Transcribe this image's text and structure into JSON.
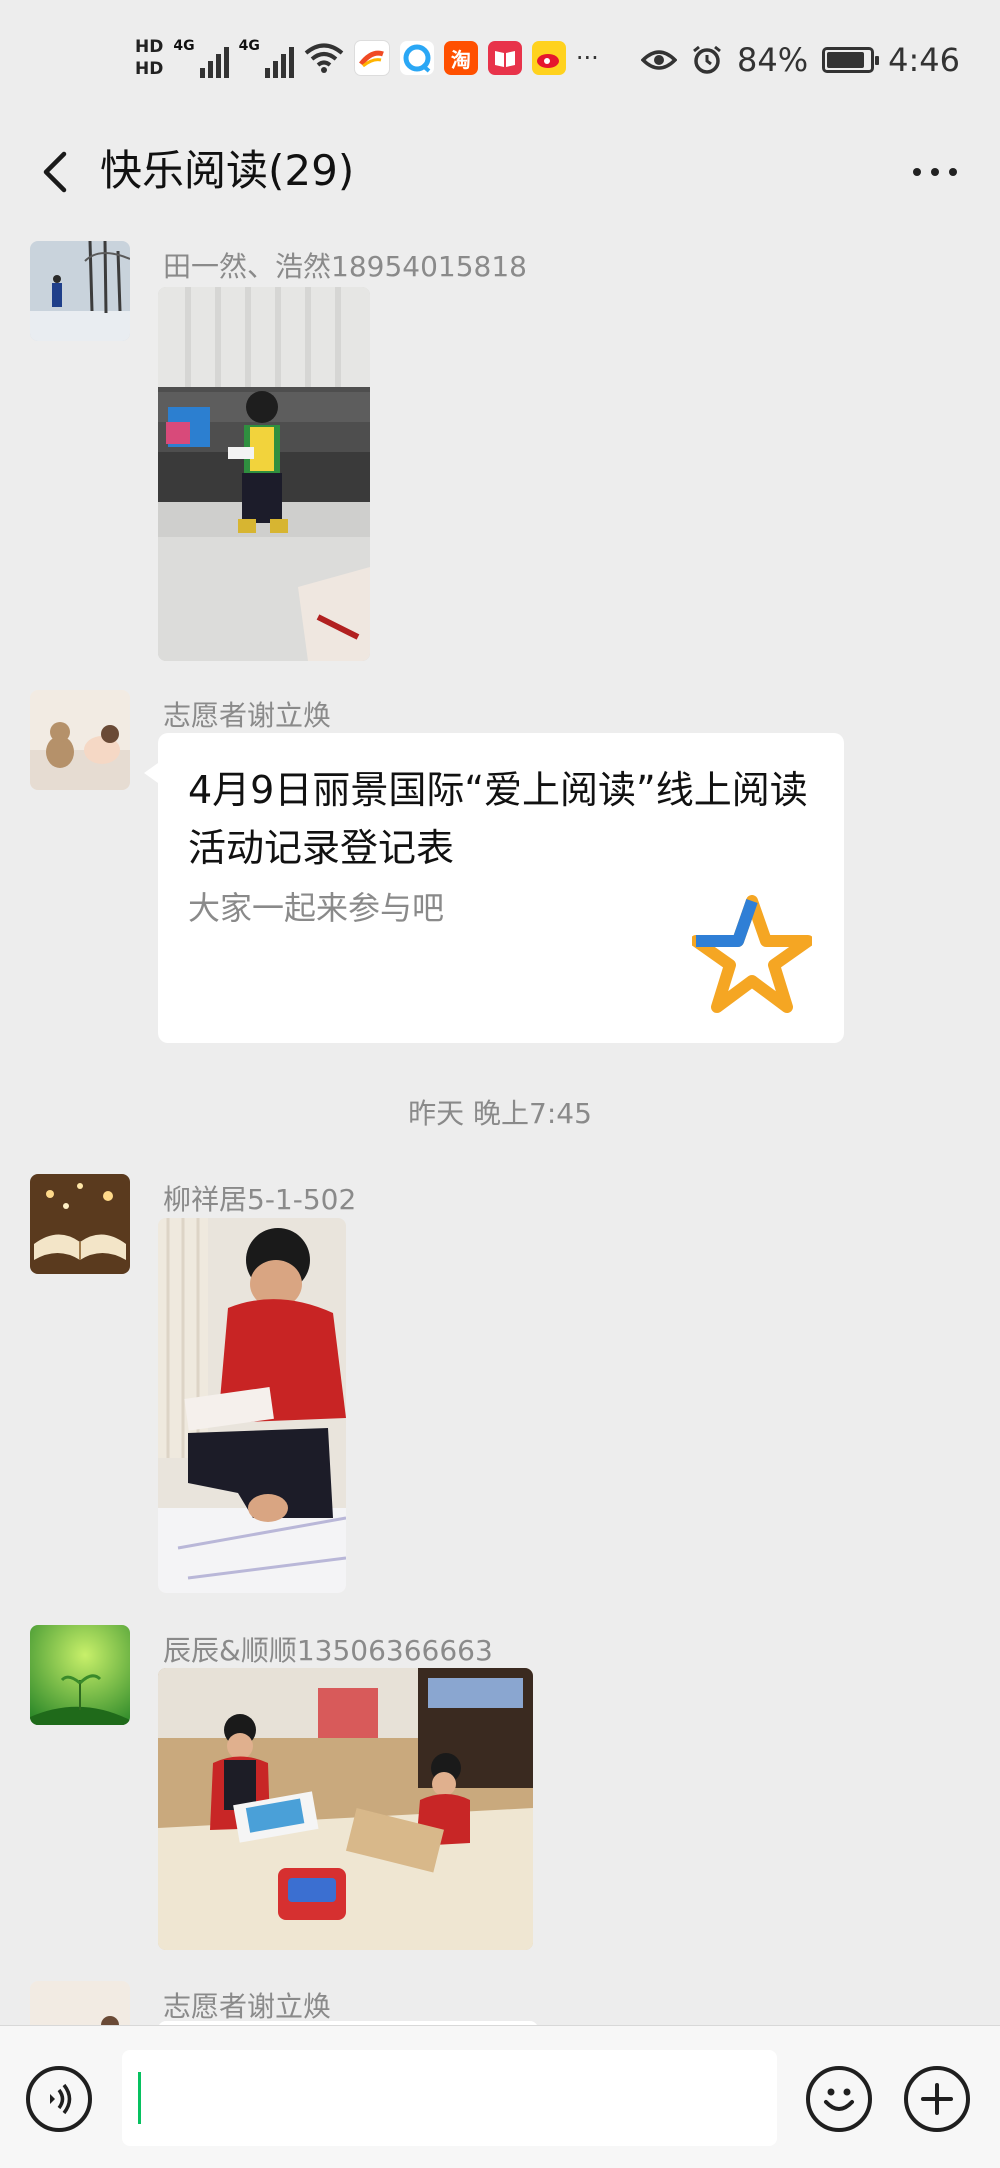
{
  "status_bar": {
    "hd1": "HD",
    "hd2": "HD",
    "net1": "4G",
    "net2": "4G",
    "taobao_glyph": "淘",
    "more": "···",
    "battery": "84%",
    "time": "4:46",
    "icons": [
      "signal-icon",
      "wifi-icon",
      "app-icon",
      "browser-icon",
      "taobao-icon",
      "reader-icon",
      "weibo-icon",
      "eye-icon",
      "alarm-icon",
      "battery-icon"
    ]
  },
  "header": {
    "title": "快乐阅读(29)"
  },
  "messages": [
    {
      "sender": "田一然、浩然18954015818",
      "type": "image"
    },
    {
      "sender": "志愿者谢立焕",
      "type": "link-card",
      "card_title": "4月9日丽景国际“爱上阅读”线上阅读活动记录登记表",
      "card_desc": "大家一起来参与吧"
    },
    {
      "type": "timestamp",
      "text": "昨天 晚上7:45"
    },
    {
      "sender": "柳祥居5-1-502",
      "type": "image"
    },
    {
      "sender": "辰辰&顺顺13506366663",
      "type": "image"
    },
    {
      "sender": "志愿者谢立焕",
      "type": "partial"
    }
  ],
  "input_bar": {
    "value": "",
    "icons": [
      "voice-icon",
      "emoji-icon",
      "plus-icon"
    ]
  },
  "colors": {
    "background": "#ededed",
    "accent": "#07c160",
    "secondary_text": "#8a8a8a"
  }
}
